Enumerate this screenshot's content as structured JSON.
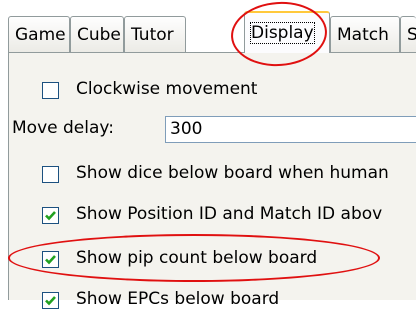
{
  "tabs": [
    {
      "label": "Game"
    },
    {
      "label": "Cube"
    },
    {
      "label": "Tutor"
    },
    {
      "label": "Display"
    },
    {
      "label": "Match"
    },
    {
      "label": "S"
    }
  ],
  "display": {
    "clockwise_label": "Clockwise movement",
    "clockwise_checked": false,
    "move_delay_label": "Move delay:",
    "move_delay_value": "300",
    "show_dice_label": "Show dice below board when human",
    "show_dice_checked": false,
    "show_position_label": "Show Position ID and Match ID abov",
    "show_position_checked": true,
    "show_pip_label": "Show pip count below board",
    "show_pip_checked": true,
    "show_epc_label": "Show EPCs below board",
    "show_epc_checked": true
  },
  "annotations": {
    "color": "#e01010"
  }
}
